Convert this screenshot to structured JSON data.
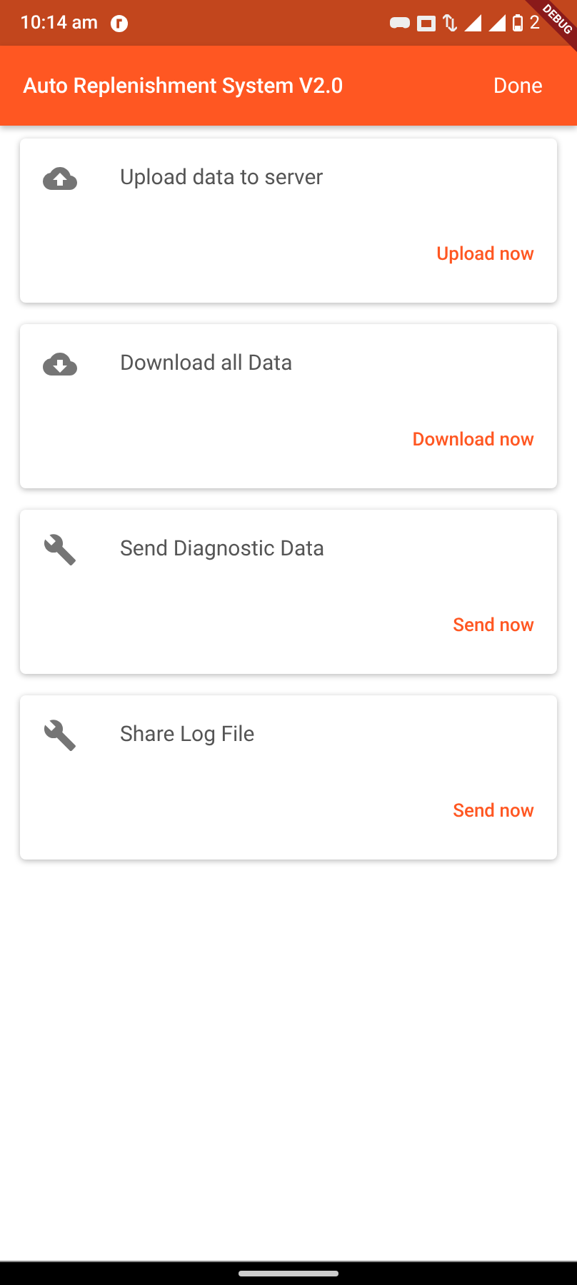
{
  "status_bar": {
    "time": "10:14 am",
    "battery": "2",
    "debug_banner": "DEBUG"
  },
  "app_bar": {
    "title": "Auto Replenishment System V2.0",
    "action": "Done"
  },
  "cards": [
    {
      "kind": "upload",
      "title": "Upload data to server",
      "action": "Upload now"
    },
    {
      "kind": "download",
      "title": "Download all Data",
      "action": "Download now"
    },
    {
      "kind": "tool",
      "title": "Send Diagnostic Data",
      "action": "Send now"
    },
    {
      "kind": "tool",
      "title": "Share Log File",
      "action": "Send now"
    }
  ]
}
